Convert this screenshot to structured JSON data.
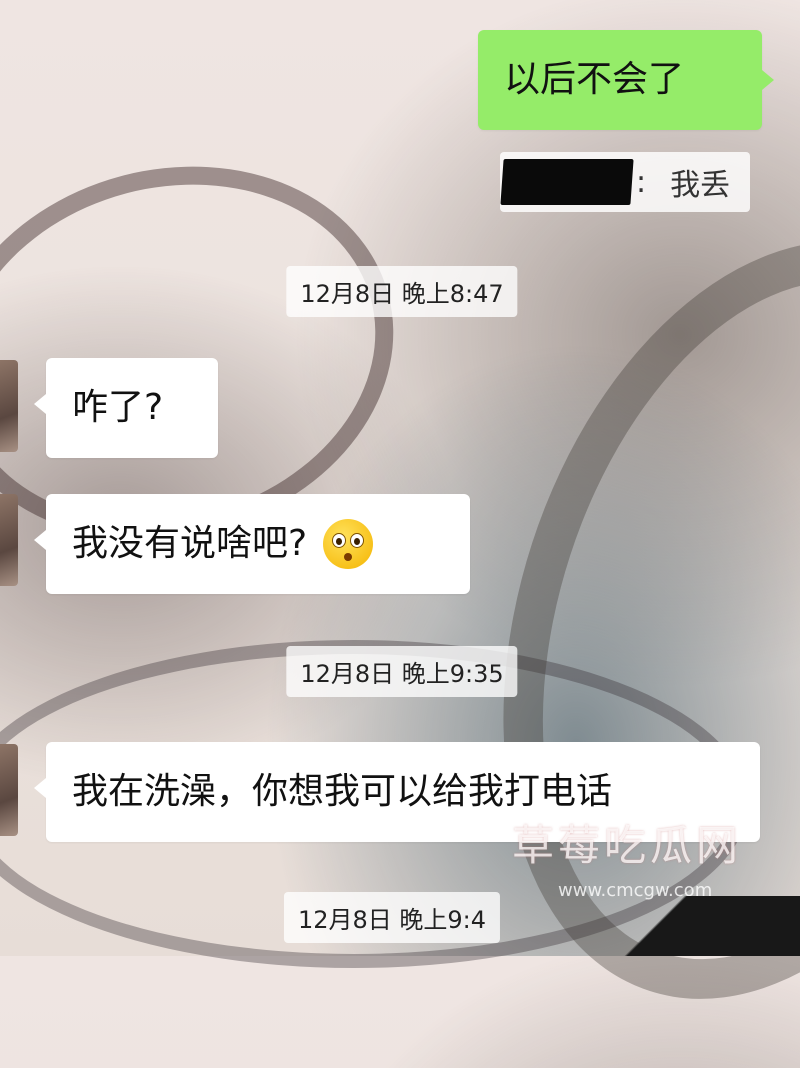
{
  "messages": [
    {
      "side": "right",
      "text": "以后不会了"
    },
    {
      "side": "left",
      "text": "咋了?"
    },
    {
      "side": "left",
      "text": "我没有说啥吧?"
    },
    {
      "side": "left",
      "text": "我在洗澡，你想我可以给我打电话"
    }
  ],
  "quote": {
    "separator": ":",
    "text": "我丢"
  },
  "timestamps": [
    "12月8日 晚上8:47",
    "12月8日 晚上9:35",
    "12月8日 晚上9:4"
  ],
  "emoji": "flushed-face-icon",
  "watermark": {
    "text": "草莓吃瓜网",
    "url": "www.cmcgw.com"
  },
  "colors": {
    "sent_bubble": "#95ec69",
    "received_bubble": "#ffffff"
  }
}
